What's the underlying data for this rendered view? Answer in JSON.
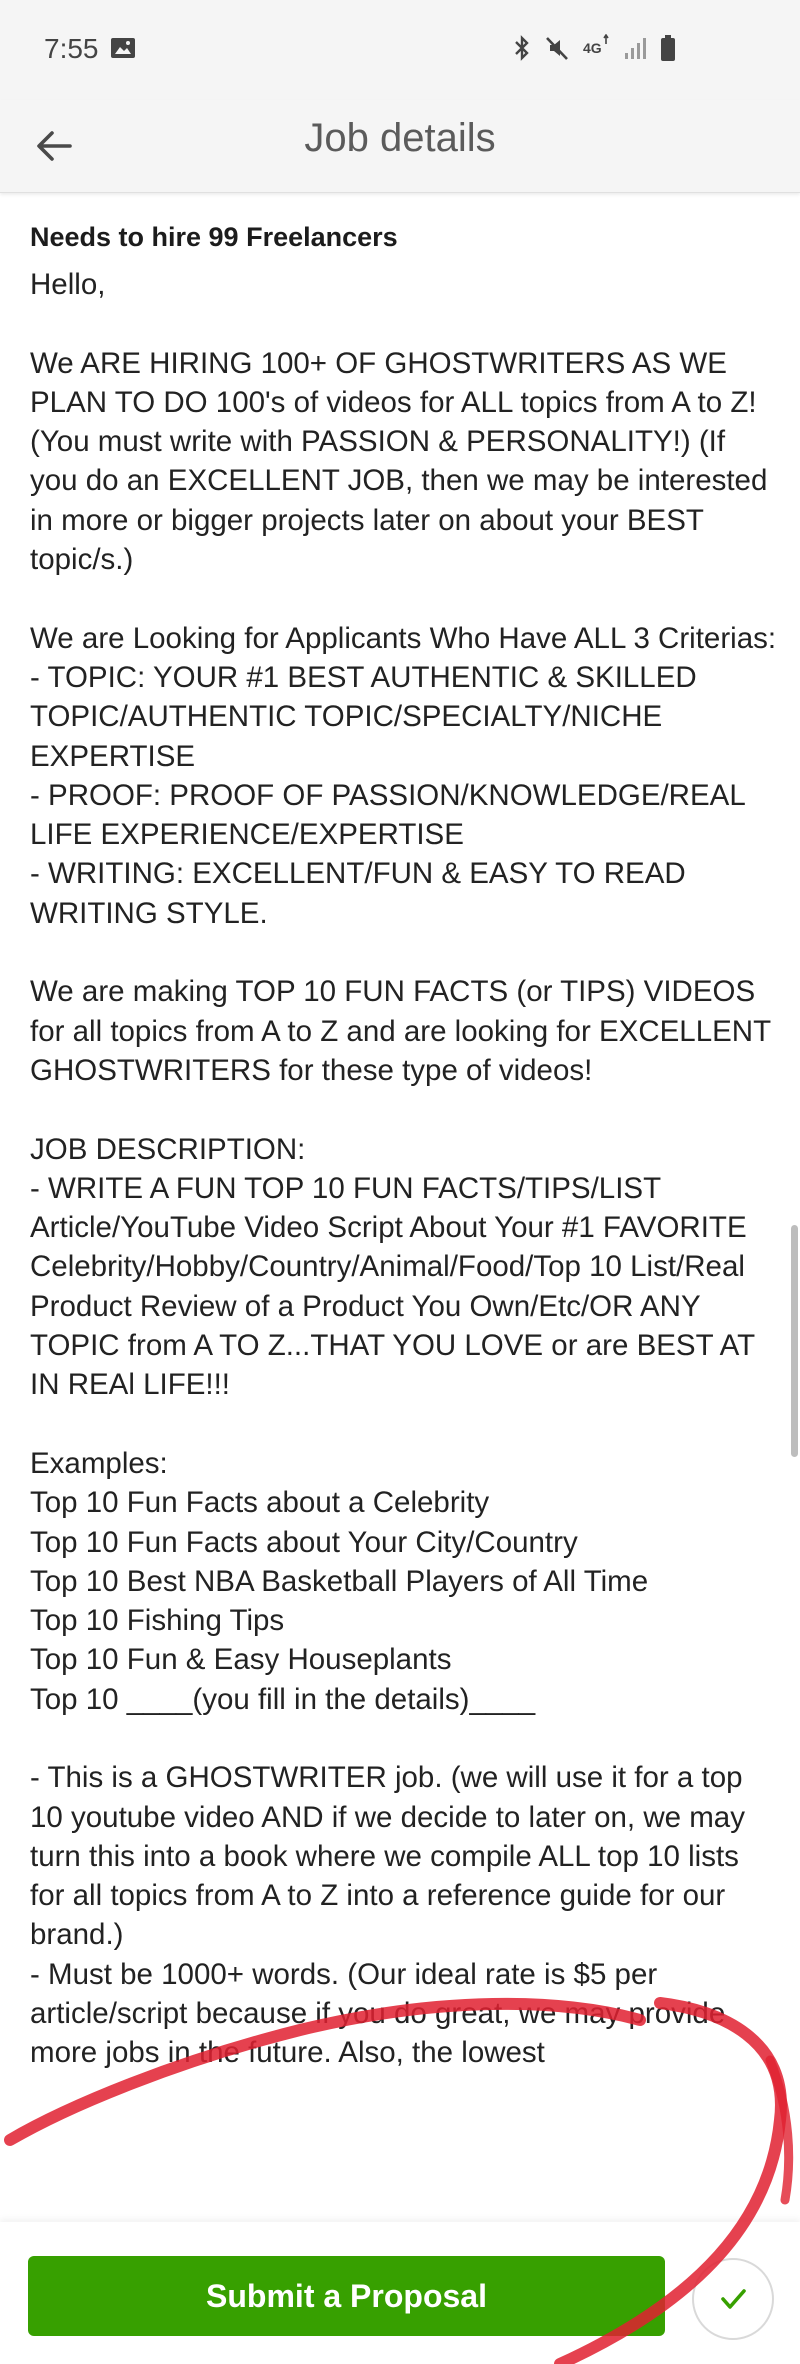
{
  "status_bar": {
    "time": "7:55",
    "icons": [
      "photo-icon",
      "bluetooth-icon",
      "mute-icon",
      "4g-signal-icon",
      "signal-icon",
      "battery-icon"
    ]
  },
  "app_bar": {
    "title": "Job details",
    "back_icon": "arrow-left-icon"
  },
  "job": {
    "hire_heading": "Needs to hire 99 Freelancers",
    "description": "Hello,\n\nWe ARE HIRING 100+ OF GHOSTWRITERS AS WE PLAN TO DO 100's of videos for ALL topics from A to Z! (You must write with PASSION & PERSONALITY!) (If you do an EXCELLENT JOB, then we may be interested in more or bigger projects later on about your BEST topic/s.)\n\nWe are Looking for Applicants Who Have ALL 3 Criterias:\n- TOPIC: YOUR #1 BEST AUTHENTIC & SKILLED TOPIC/AUTHENTIC TOPIC/SPECIALTY/NICHE EXPERTISE\n- PROOF: PROOF OF PASSION/KNOWLEDGE/REAL LIFE EXPERIENCE/EXPERTISE\n- WRITING: EXCELLENT/FUN & EASY TO READ WRITING STYLE.\n\nWe are making TOP 10 FUN FACTS (or TIPS) VIDEOS for all topics from A to Z and are looking for EXCELLENT GHOSTWRITERS for these type of videos!\n\nJOB DESCRIPTION:\n- WRITE A FUN TOP 10 FUN FACTS/TIPS/LIST Article/YouTube Video Script About Your #1 FAVORITE Celebrity/Hobby/Country/Animal/Food/Top 10 List/Real Product Review of a Product You Own/Etc/OR ANY TOPIC from A TO Z...THAT YOU LOVE or are BEST AT IN REAl LIFE!!!\n\nExamples:\nTop 10 Fun Facts about a Celebrity\nTop 10 Fun Facts about Your City/Country\nTop 10 Best NBA Basketball Players of All Time\nTop 10 Fishing Tips\nTop 10 Fun & Easy Houseplants\nTop 10 ____(you fill in the details)____\n\n- This is a GHOSTWRITER job. (we will use it for a top 10 youtube video AND if we decide to later on, we may turn this into a book where we compile ALL top 10 lists for all topics from A to Z into a reference guide for our brand.)\n- Must be 1000+ words. (Our ideal rate is $5 per article/script because if you do great, we may provide more jobs in the future. Also, the lowest"
  },
  "actions": {
    "submit_label": "Submit a Proposal",
    "favorite_icon": "heart-check-icon"
  },
  "colors": {
    "accent": "#37a000",
    "annotation": "#e02030"
  }
}
